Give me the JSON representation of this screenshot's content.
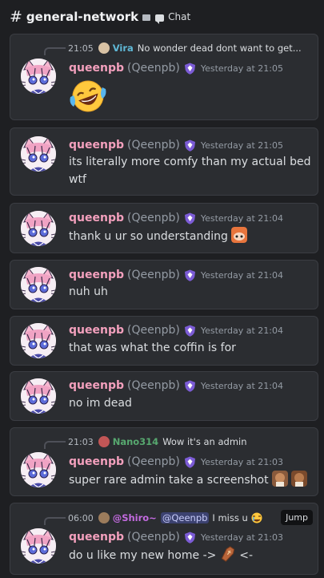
{
  "header": {
    "hash": "#",
    "channel": "general-network",
    "chat_label": "Chat"
  },
  "user": {
    "name": "queenpb",
    "handle": "(Qeenpb)"
  },
  "messages": [
    {
      "reply_time": "21:05",
      "reply_user": "Vira",
      "reply_user_color": "#5fb8d6",
      "reply_text": "No wonder dead dont want to get...",
      "time": "Yesterday at 21:05",
      "text": "",
      "emoji": "laughing-crying-emoji"
    },
    {
      "time": "Yesterday at 21:05",
      "text": "its literally more comfy than my actual bed wtf"
    },
    {
      "time": "Yesterday at 21:04",
      "text": "thank u ur so understanding"
    },
    {
      "time": "Yesterday at 21:04",
      "text": "nuh uh"
    },
    {
      "time": "Yesterday at 21:04",
      "text": "that was what the coffin is for"
    },
    {
      "time": "Yesterday at 21:04",
      "text": "no im dead"
    },
    {
      "reply_time": "21:03",
      "reply_user": "Nano314",
      "reply_user_color": "#57a86f",
      "reply_text": "Wow it's an admin",
      "time": "Yesterday at 21:03",
      "text": "super rare admin take a screenshot"
    },
    {
      "reply_time": "06:00",
      "reply_user": "@Shiro~",
      "reply_user_color": "#c36be0",
      "reply_mention": "@Qeenpb",
      "reply_text": "I miss u",
      "time": "Yesterday at 21:03",
      "text_a": "do u like my new home ->",
      "text_b": "<-",
      "jump_label": "Jump"
    }
  ],
  "colors": {
    "background": "#1e1f22",
    "card": "#2b2d31",
    "username": "#f3a0bd",
    "badge": "#7c5cd6"
  }
}
